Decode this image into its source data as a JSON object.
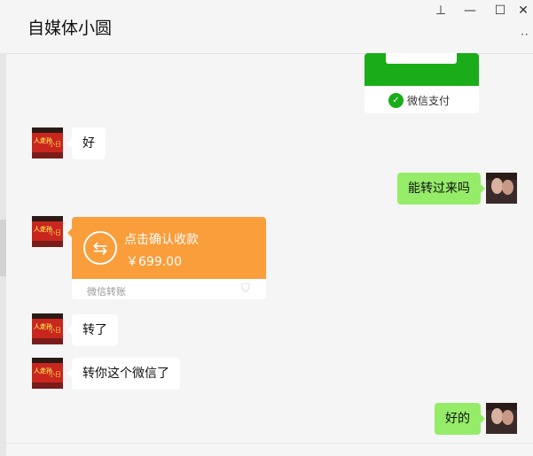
{
  "header": {
    "title": "自媒体小圆",
    "more_label": "··"
  },
  "window_controls": {
    "pin": "⊥",
    "minimize": "—",
    "maximize": "☐",
    "close": "✕"
  },
  "pay_card": {
    "label": "微信支付",
    "icon": "wechat-pay-icon",
    "color": "#1aad19"
  },
  "messages": [
    {
      "side": "left",
      "text": "好"
    },
    {
      "side": "right",
      "text": "能转过来吗"
    },
    {
      "side": "left",
      "type": "transfer"
    },
    {
      "side": "left",
      "text": "转了"
    },
    {
      "side": "left",
      "text": "转你这个微信了"
    },
    {
      "side": "right",
      "text": "好的"
    }
  ],
  "transfer": {
    "title": "点击确认收款",
    "amount": "￥699.00",
    "footer": "微信转账",
    "color": "#fa9d3b",
    "icon": "transfer-arrows-icon"
  },
  "avatar_text": {
    "left_line1": "人走孙",
    "left_line2": "小日"
  },
  "colors": {
    "self_bubble": "#95ec69",
    "other_bubble": "#ffffff",
    "background": "#f5f5f5"
  }
}
